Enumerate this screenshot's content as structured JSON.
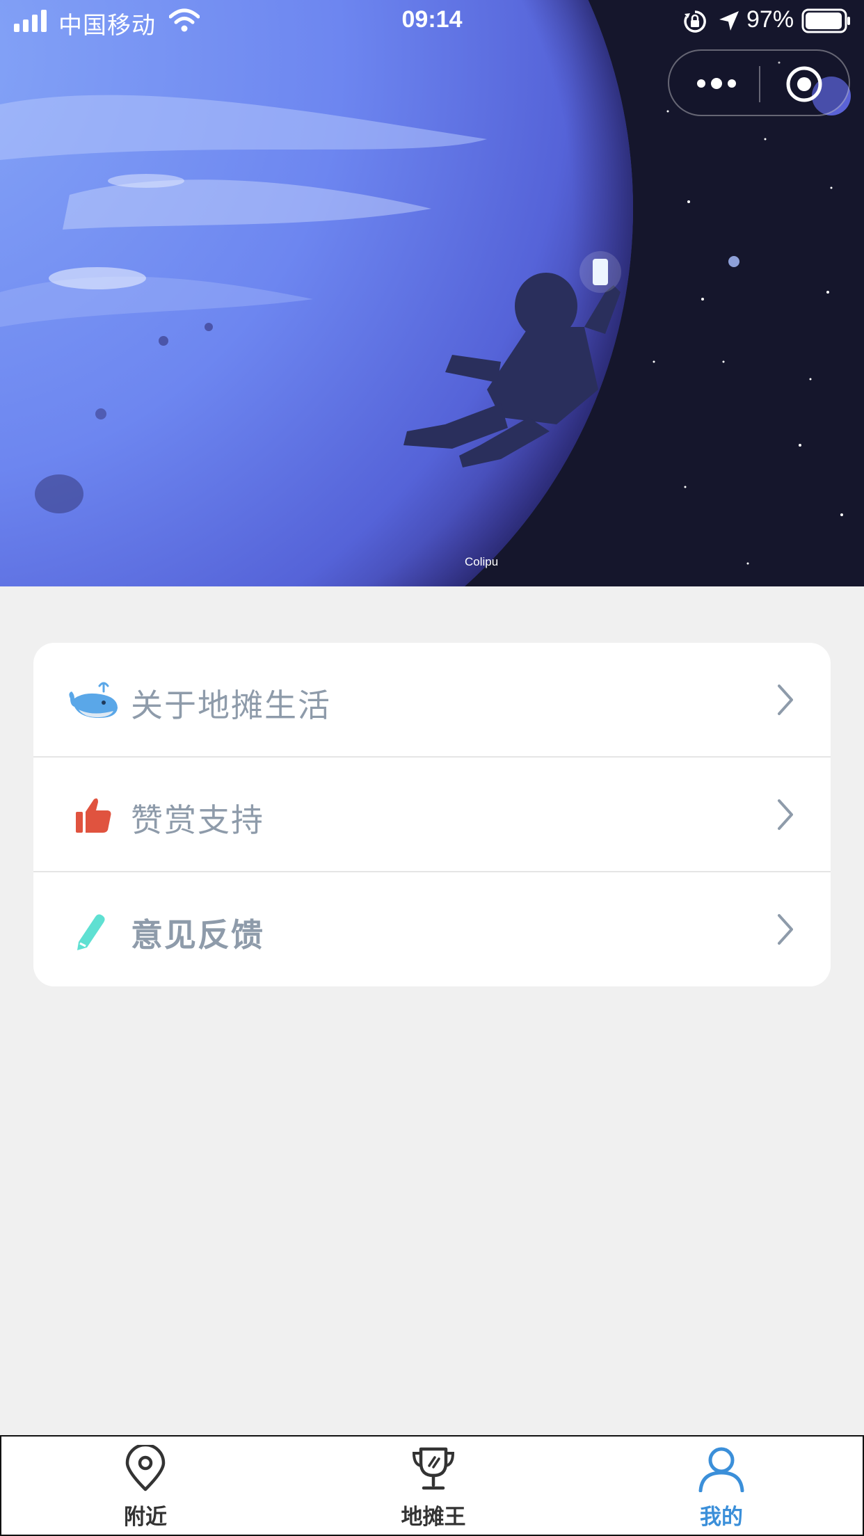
{
  "status_bar": {
    "carrier": "中国移动",
    "time": "09:14",
    "battery": "97%"
  },
  "hero": {
    "credit": "Colipu"
  },
  "menu": {
    "items": [
      {
        "label": "关于地摊生活",
        "icon": "whale-icon",
        "icon_color": "#5aa7e8"
      },
      {
        "label": "赞赏支持",
        "icon": "thumbs-up-icon",
        "icon_color": "#e0533f"
      },
      {
        "label": "意见反馈",
        "icon": "pencil-icon",
        "icon_color": "#5fe0d2"
      }
    ]
  },
  "tabbar": {
    "tabs": [
      {
        "label": "附近",
        "icon": "location-pin-icon"
      },
      {
        "label": "地摊王",
        "icon": "trophy-icon"
      },
      {
        "label": "我的",
        "icon": "user-icon"
      }
    ],
    "active_color": "#3b8fd9",
    "inactive_color": "#333333"
  }
}
